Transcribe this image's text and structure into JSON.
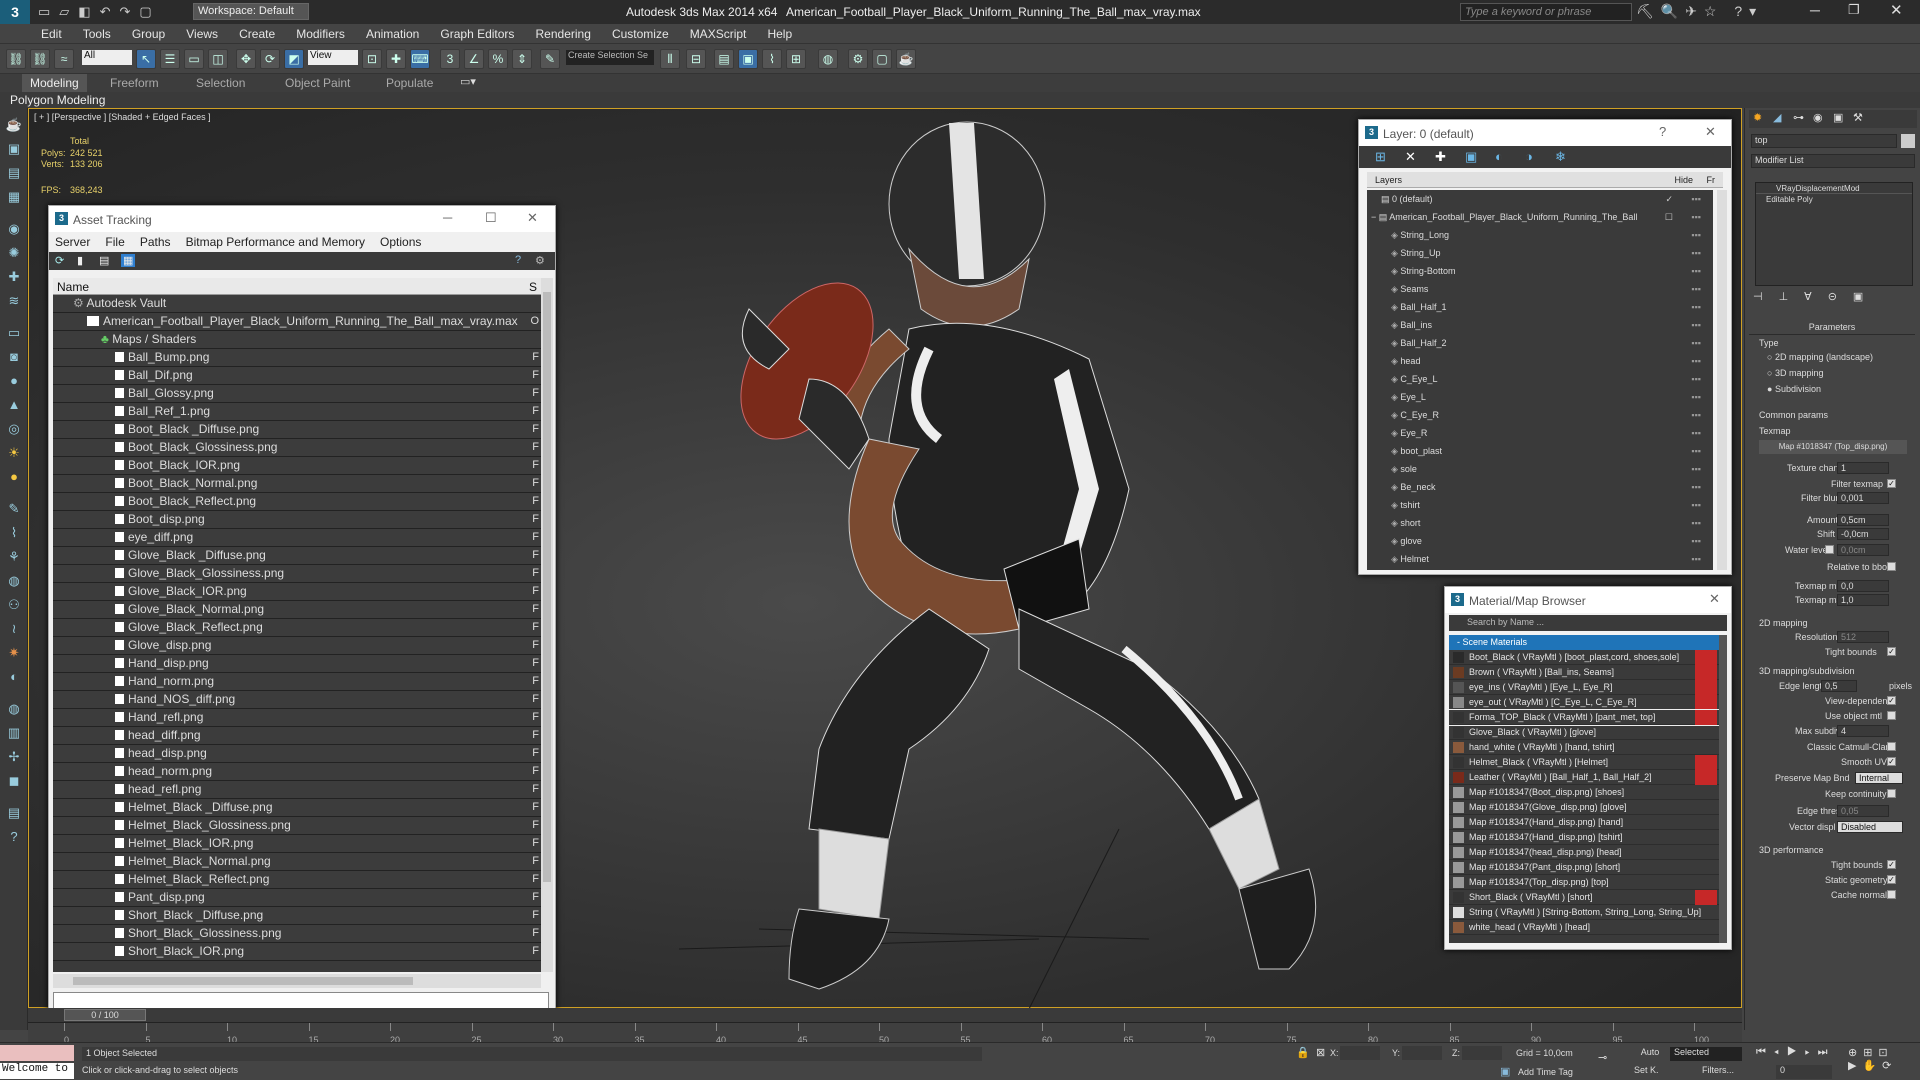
{
  "titlebar": {
    "workspace": "Workspace: Default",
    "app": "Autodesk 3ds Max  2014 x64",
    "file": "American_Football_Player_Black_Uniform_Running_The_Ball_max_vray.max",
    "search_placeholder": "Type a keyword or phrase"
  },
  "menu": [
    "Edit",
    "Tools",
    "Group",
    "Views",
    "Create",
    "Modifiers",
    "Animation",
    "Graph Editors",
    "Rendering",
    "Customize",
    "MAXScript",
    "Help"
  ],
  "toolbar": {
    "filter": "All",
    "refcoord": "View",
    "selset": "Create Selection Se"
  },
  "ribbon": {
    "tabs": [
      "Modeling",
      "Freeform",
      "Selection",
      "Object Paint",
      "Populate"
    ],
    "sub": "Polygon Modeling"
  },
  "viewport": {
    "label": "[ + ] [Perspective ] [Shaded + Edged Faces ]",
    "total": "Total",
    "polys_label": "Polys:",
    "polys": "242 521",
    "verts_label": "Verts:",
    "verts": "133 206",
    "fps_label": "FPS:",
    "fps": "368,243"
  },
  "asset_tracking": {
    "title": "Asset Tracking",
    "menu": [
      "Server",
      "File",
      "Paths",
      "Bitmap Performance and Memory",
      "Options"
    ],
    "col_name": "Name",
    "col_s": "S",
    "root": "Autodesk Vault",
    "maxfile": "American_Football_Player_Black_Uniform_Running_The_Ball_max_vray.max",
    "maps": "Maps / Shaders",
    "files": [
      "Ball_Bump.png",
      "Ball_Dif.png",
      "Ball_Glossy.png",
      "Ball_Ref_1.png",
      "Boot_Black _Diffuse.png",
      "Boot_Black_Glossiness.png",
      "Boot_Black_IOR.png",
      "Boot_Black_Normal.png",
      "Boot_Black_Reflect.png",
      "Boot_disp.png",
      "eye_diff.png",
      "Glove_Black _Diffuse.png",
      "Glove_Black_Glossiness.png",
      "Glove_Black_IOR.png",
      "Glove_Black_Normal.png",
      "Glove_Black_Reflect.png",
      "Glove_disp.png",
      "Hand_disp.png",
      "Hand_norm.png",
      "Hand_NOS_diff.png",
      "Hand_refl.png",
      "head_diff.png",
      "head_disp.png",
      "head_norm.png",
      "head_refl.png",
      "Helmet_Black _Diffuse.png",
      "Helmet_Black_Glossiness.png",
      "Helmet_Black_IOR.png",
      "Helmet_Black_Normal.png",
      "Helmet_Black_Reflect.png",
      "Pant_disp.png",
      "Short_Black _Diffuse.png",
      "Short_Black_Glossiness.png",
      "Short_Black_IOR.png"
    ],
    "found_flag": "F"
  },
  "layer": {
    "title": "Layer: 0 (default)",
    "help": "?",
    "col_layers": "Layers",
    "col_hide": "Hide",
    "col_fr": "Fr",
    "default_layer": "0 (default)",
    "main_layer": "American_Football_Player_Black_Uniform_Running_The_Ball",
    "objects": [
      "String_Long",
      "String_Up",
      "String-Bottom",
      "Seams",
      "Ball_Half_1",
      "Ball_ins",
      "Ball_Half_2",
      "head",
      "C_Eye_L",
      "Eye_L",
      "C_Eye_R",
      "Eye_R",
      "boot_plast",
      "sole",
      "Be_neck",
      "tshirt",
      "short",
      "glove",
      "Helmet"
    ]
  },
  "material_browser": {
    "title": "Material/Map Browser",
    "search": "Search by Name ...",
    "section": "- Scene Materials",
    "materials": [
      {
        "name": "Boot_Black  ( VRayMtl ) [boot_plast,cord, shoes,sole]",
        "swatch": "#2a2a2a",
        "flag": true
      },
      {
        "name": "Brown  ( VRayMtl ) [Ball_ins, Seams]",
        "swatch": "#6b3b22",
        "flag": true
      },
      {
        "name": "eye_ins  ( VRayMtl ) [Eye_L, Eye_R]",
        "swatch": "#555",
        "flag": true
      },
      {
        "name": "eye_out  ( VRayMtl ) [C_Eye_L, C_Eye_R]",
        "swatch": "#888",
        "flag": true
      },
      {
        "name": "Forma_TOP_Black  ( VRayMtl ) [pant_met, top]",
        "swatch": "#333",
        "flag": true,
        "selected": true
      },
      {
        "name": "Glove_Black  ( VRayMtl ) [glove]",
        "swatch": "#333",
        "flag": false
      },
      {
        "name": "hand_white  ( VRayMtl ) [hand, tshirt]",
        "swatch": "#8a5a3c",
        "flag": false
      },
      {
        "name": "Helmet_Black  ( VRayMtl ) [Helmet]",
        "swatch": "#333",
        "flag": true
      },
      {
        "name": "Leather  ( VRayMtl ) [Ball_Half_1, Ball_Half_2]",
        "swatch": "#7a2a1a",
        "flag": true
      },
      {
        "name": "Map #1018347(Boot_disp.png) [shoes]",
        "swatch": "#999",
        "flag": false
      },
      {
        "name": "Map #1018347(Glove_disp.png) [glove]",
        "swatch": "#999",
        "flag": false
      },
      {
        "name": "Map #1018347(Hand_disp.png) [hand]",
        "swatch": "#999",
        "flag": false
      },
      {
        "name": "Map #1018347(Hand_disp.png) [tshirt]",
        "swatch": "#999",
        "flag": false
      },
      {
        "name": "Map #1018347(head_disp.png) [head]",
        "swatch": "#999",
        "flag": false
      },
      {
        "name": "Map #1018347(Pant_disp.png) [short]",
        "swatch": "#999",
        "flag": false
      },
      {
        "name": "Map #1018347(Top_disp.png) [top]",
        "swatch": "#999",
        "flag": false
      },
      {
        "name": "Short_Black  ( VRayMtl ) [short]",
        "swatch": "#333",
        "flag": true
      },
      {
        "name": "String  ( VRayMtl ) [String-Bottom, String_Long, String_Up]",
        "swatch": "#ddd",
        "flag": false
      },
      {
        "name": "white_head  ( VRayMtl ) [head]",
        "swatch": "#8a5a3c",
        "flag": false
      }
    ]
  },
  "command_panel": {
    "name_field": "top",
    "modifier_list": "Modifier List",
    "stack": [
      "VRayDisplacementMod",
      "Editable Poly"
    ],
    "parameters": "Parameters",
    "type": "Type",
    "type_opts": [
      "2D mapping (landscape)",
      "3D mapping",
      "Subdivision"
    ],
    "common": "Common params",
    "texmap": "Texmap",
    "texmap_btn": "Map #1018347 (Top_disp.png)",
    "texture_chan": "Texture chan",
    "texture_chan_v": "1",
    "filter_texmap": "Filter texmap",
    "filter_blur": "Filter blur",
    "filter_blur_v": "0,001",
    "amount": "Amount",
    "amount_v": "0,5cm",
    "shift": "Shift",
    "shift_v": "-0,0cm",
    "water": "Water level",
    "water_v": "0,0cm",
    "relative": "Relative to bbox",
    "texmap_min": "Texmap min",
    "texmap_min_v": "0,0",
    "texmap_max": "Texmap max",
    "texmap_max_v": "1,0",
    "mapping2d": "2D mapping",
    "resolution": "Resolution",
    "resolution_v": "512",
    "tight": "Tight bounds",
    "mapping3d": "3D mapping/subdivision",
    "edge_len": "Edge length",
    "edge_len_v": "0,5",
    "pixels": "pixels",
    "view_dep": "View-dependent",
    "use_obj": "Use object mtl",
    "max_subdivs": "Max subdivs",
    "max_subdivs_v": "4",
    "catmull": "Classic Catmull-Clark",
    "smooth_uv": "Smooth UVs",
    "preserve": "Preserve Map Bnd",
    "preserve_v": "Internal",
    "keep": "Keep continuity",
    "edge_thresh": "Edge thresh",
    "edge_thresh_v": "0,05",
    "vector": "Vector displ",
    "vector_v": "Disabled",
    "perf": "3D performance",
    "tight2": "Tight bounds",
    "static": "Static geometry",
    "cache": "Cache normals"
  },
  "timeline": {
    "slider": "0 / 100",
    "ticks": [
      "0",
      "5",
      "10",
      "15",
      "20",
      "25",
      "30",
      "35",
      "40",
      "45",
      "50",
      "55",
      "60",
      "65",
      "70",
      "75",
      "80",
      "85",
      "90",
      "95",
      "100"
    ]
  },
  "status": {
    "welcome": "Welcome to",
    "selected": "1 Object Selected",
    "prompt": "Click or click-and-drag to select objects",
    "x": "X:",
    "y": "Y:",
    "z": "Z:",
    "grid": "Grid = 10,0cm",
    "add_time_tag": "Add Time Tag",
    "auto": "Auto",
    "setk": "Set K.",
    "selected_dd": "Selected",
    "filters": "Filters...",
    "frame": "0"
  }
}
